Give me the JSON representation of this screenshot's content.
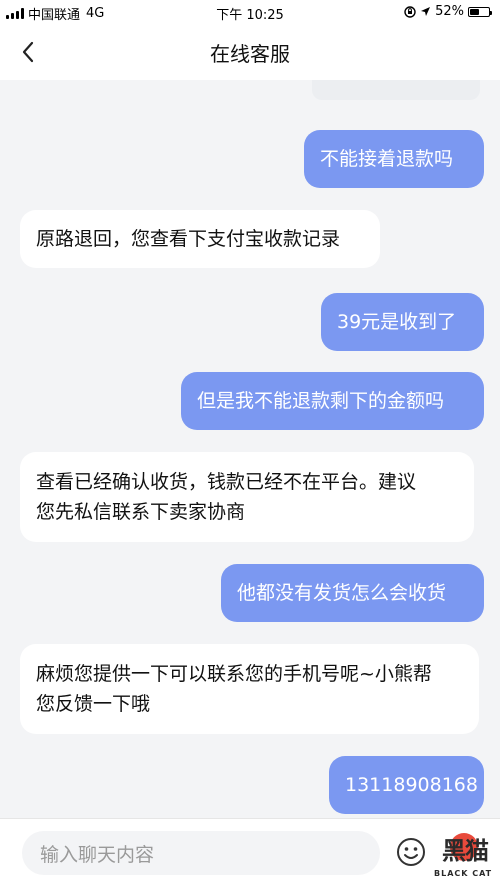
{
  "status_bar": {
    "carrier": "中国联通",
    "network": "4G",
    "time": "下午 10:25",
    "battery_percent_label": "52%",
    "battery_level": 0.52
  },
  "nav": {
    "title": "在线客服"
  },
  "messages": [
    {
      "direction": "outgoing",
      "text": "不能接着退款吗"
    },
    {
      "direction": "incoming",
      "text": "原路退回，您查看下支付宝收款记录"
    },
    {
      "direction": "outgoing",
      "text": "39元是收到了"
    },
    {
      "direction": "outgoing",
      "text": "但是我不能退款剩下的金额吗"
    },
    {
      "direction": "incoming",
      "text_lines": [
        "查看已经确认收货，钱款已经不在平台。建议",
        "您先私信联系下卖家协商"
      ]
    },
    {
      "direction": "outgoing",
      "text": "他都没有发货怎么会收货"
    },
    {
      "direction": "incoming",
      "text_lines": [
        "麻烦您提供一下可以联系您的手机号呢~小熊帮",
        "您反馈一下哦"
      ]
    },
    {
      "direction": "outgoing",
      "text": "13118908168"
    }
  ],
  "input": {
    "placeholder": "输入聊天内容"
  },
  "watermark": {
    "text": "黑猫",
    "subtext": "BLACK CAT"
  },
  "colors": {
    "outgoing_bubble": "#7b98f1",
    "incoming_bubble": "#ffffff",
    "background": "#f3f4f6",
    "watermark_accent": "#e84a3c"
  },
  "icons": {
    "back": "chevron-left-icon",
    "emoji": "smiley-icon",
    "location": "location-arrow-icon",
    "lock": "orientation-lock-icon",
    "signal": "signal-bars-icon",
    "battery": "battery-icon"
  }
}
